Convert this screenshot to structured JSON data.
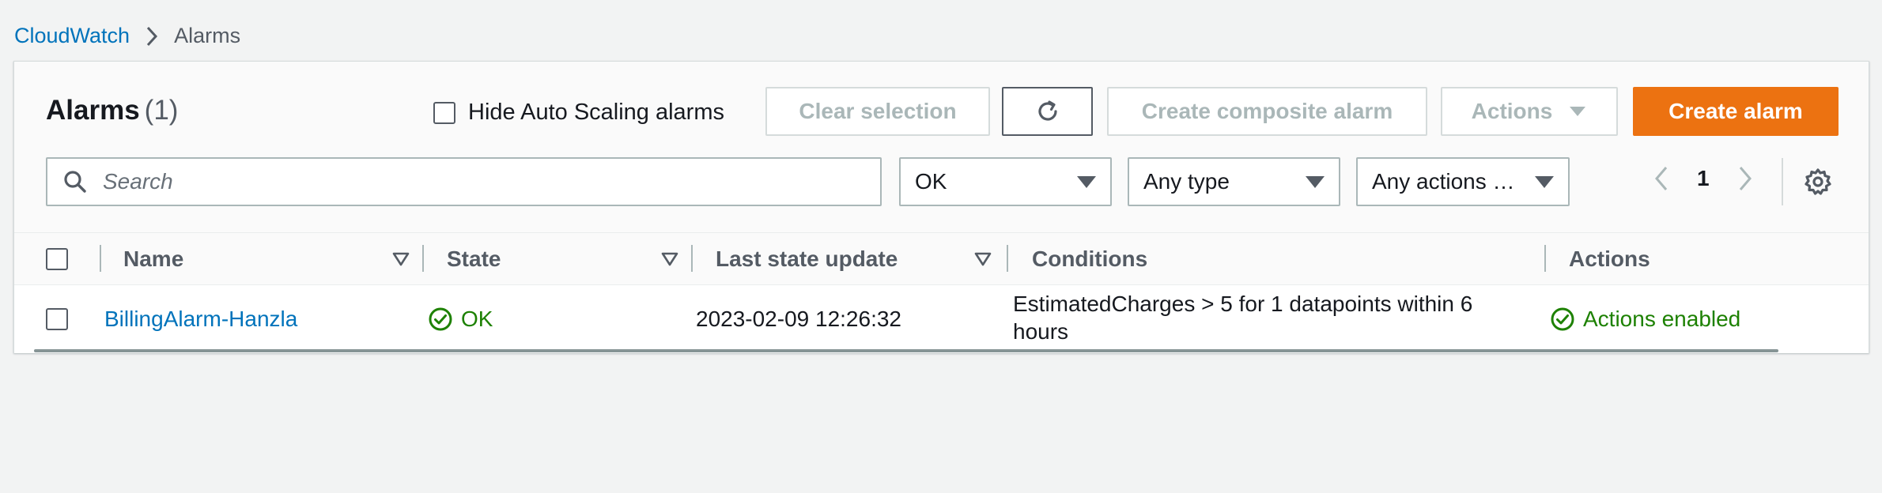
{
  "breadcrumb": {
    "root": "CloudWatch",
    "current": "Alarms"
  },
  "header": {
    "title": "Alarms",
    "count": "(1)",
    "hide_auto_scaling_label": "Hide Auto Scaling alarms"
  },
  "toolbar": {
    "clear_selection": "Clear selection",
    "create_composite": "Create composite alarm",
    "actions": "Actions",
    "create_alarm": "Create alarm"
  },
  "filters": {
    "search_placeholder": "Search",
    "state_value": "OK",
    "type_value": "Any type",
    "actions_value": "Any actions …"
  },
  "pagination": {
    "page": "1"
  },
  "table": {
    "columns": [
      "Name",
      "State",
      "Last state update",
      "Conditions",
      "Actions"
    ],
    "rows": [
      {
        "name": "BillingAlarm-Hanzla",
        "state": "OK",
        "last_update": "2023-02-09 12:26:32",
        "conditions": "EstimatedCharges > 5 for 1 datapoints within 6 hours",
        "actions": "Actions enabled"
      }
    ]
  },
  "colors": {
    "link": "#0073bb",
    "primary_button": "#ec7211",
    "success": "#1d8102",
    "disabled_text": "#aab7b8"
  },
  "icons": {
    "breadcrumb_separator": "chevron-right-icon",
    "refresh": "refresh-icon",
    "search": "search-icon",
    "settings": "gear-icon",
    "status_ok": "check-circle-icon"
  }
}
